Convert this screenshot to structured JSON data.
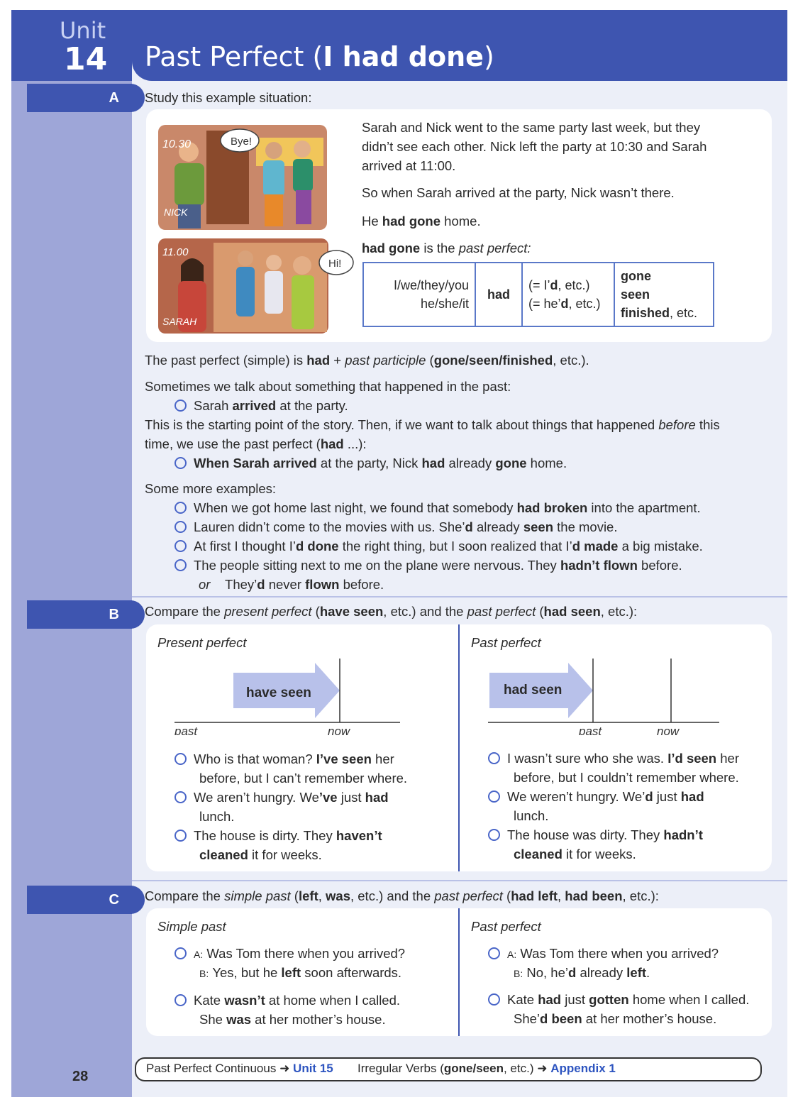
{
  "header": {
    "unit_word": "Unit",
    "unit_number": "14",
    "title_plain": "Past Perfect (",
    "title_bold": "I had done",
    "title_close": ")"
  },
  "sectionA": {
    "tab": "A",
    "intro": "Study this example situation:",
    "illustration": {
      "time1": "10.30",
      "bubble1": "Bye!",
      "name1": "NICK",
      "time2": "11.00",
      "bubble2": "Hi!",
      "name2": "SARAH"
    },
    "para1_line1": "Sarah and Nick went to the same party last week, but they",
    "para1_line2": "didn’t see each other.  Nick left the party at 10:30 and Sarah",
    "para1_line3": "arrived at 11:00.",
    "para2": "So when Sarah arrived at the party, Nick wasn’t there.",
    "para3_pre": "He ",
    "para3_bold": "had gone",
    "para3_post": " home.",
    "para4_bold": "had gone",
    "para4_mid": " is the ",
    "para4_ital": "past perfect:",
    "table": {
      "subj1": "I/we/they/you",
      "subj2": "he/she/it",
      "aux": "had",
      "c1a": "(= I’",
      "c1b": "d",
      "c1c": ", etc.)",
      "c2a": "(= he’",
      "c2b": "d",
      "c2c": ", etc.)",
      "p1": "gone",
      "p2": "seen",
      "p3": "finished",
      "p3_post": ", etc."
    },
    "def_pre": "The past perfect (simple) is ",
    "def_had": "had",
    "def_plus": " + ",
    "def_ital": "past participle",
    "def_open": " (",
    "def_bold": "gone/seen/finished",
    "def_post": ", etc.).",
    "some_past": "Sometimes we talk about something that happened in the past:",
    "ex1_pre": "Sarah ",
    "ex1_bold": "arrived",
    "ex1_post": " at the party.",
    "start_line1_pre": "This is the starting point of the story.  Then, if we want to talk about things that happened ",
    "start_line1_ital": "before",
    "start_line1_post": " this",
    "start_line2_pre": "time, we use the past perfect (",
    "start_line2_bold": "had",
    "start_line2_post": " ...):",
    "ex2_b1": "When Sarah arrived",
    "ex2_m1": " at the party, Nick ",
    "ex2_b2": "had",
    "ex2_m2": " already ",
    "ex2_b3": "gone",
    "ex2_m3": " home.",
    "more": "Some more examples:",
    "m1_pre": "When we got home last night, we found that somebody ",
    "m1_bold": "had broken",
    "m1_post": " into the apartment.",
    "m2_pre": "Lauren didn’t come to the movies with us.  She’",
    "m2_b1": "d",
    "m2_mid": " already ",
    "m2_b2": "seen",
    "m2_post": " the movie.",
    "m3_pre": "At first I thought I’",
    "m3_b1": "d done",
    "m3_mid": " the right thing, but I soon realized that I’",
    "m3_b2": "d made",
    "m3_post": " a big mistake.",
    "m4_pre": "The people sitting next to me on the plane were nervous.  They ",
    "m4_bold": "hadn’t flown",
    "m4_post": " before.",
    "m5_or": "or",
    "m5_pre": "They’",
    "m5_b1": "d",
    "m5_mid": " never ",
    "m5_b2": "flown",
    "m5_post": " before."
  },
  "sectionB": {
    "tab": "B",
    "intro_pre": "Compare the ",
    "intro_i1": "present perfect",
    "intro_m1": " (",
    "intro_b1": "have seen",
    "intro_m2": ", etc.) and the ",
    "intro_i2": "past perfect",
    "intro_m3": " (",
    "intro_b2": "had seen",
    "intro_post": ", etc.):",
    "left_heading": "Present perfect",
    "left_arrow": "have seen",
    "left_past": "past",
    "left_now": "now",
    "right_heading": "Past perfect",
    "right_arrow": "had seen",
    "right_past": "past",
    "right_now": "now",
    "l1a_pre": "Who is that woman?  ",
    "l1a_bold": "I’ve seen",
    "l1a_post": " her",
    "l1b": "before, but I can’t remember where.",
    "l2a_pre": "We aren’t hungry.  We",
    "l2a_b1": "’ve",
    "l2a_mid": " just ",
    "l2a_b2": "had",
    "l2b": "lunch.",
    "l3a_pre": "The house is dirty.  They ",
    "l3a_bold": "haven’t",
    "l3b_bold": "cleaned",
    "l3b_post": " it for weeks.",
    "r1a_pre": "I wasn’t sure who she was.  ",
    "r1a_bold": "I’d seen",
    "r1a_post": " her",
    "r1b": "before, but I couldn’t remember where.",
    "r2a_pre": "We weren’t hungry.  We’",
    "r2a_b1": "d",
    "r2a_mid": " just ",
    "r2a_b2": "had",
    "r2b": "lunch.",
    "r3a_pre": "The house was dirty.  They ",
    "r3a_bold": "hadn’t",
    "r3b_bold": "cleaned",
    "r3b_post": " it for weeks."
  },
  "sectionC": {
    "tab": "C",
    "intro_pre": "Compare the ",
    "intro_i1": "simple past",
    "intro_m1": " (",
    "intro_b1": "left",
    "intro_c1": ", ",
    "intro_b2": "was",
    "intro_m2": ", etc.) and the ",
    "intro_i2": "past perfect",
    "intro_m3": " (",
    "intro_b3": "had left",
    "intro_c2": ", ",
    "intro_b4": "had been",
    "intro_post": ", etc.):",
    "left_heading": "Simple past",
    "right_heading": "Past perfect",
    "A": "A:",
    "B": "B:",
    "l1a": "Was Tom there when you arrived?",
    "l1b_pre": "Yes, but he ",
    "l1b_bold": "left",
    "l1b_post": " soon afterwards.",
    "l2a_pre": "Kate ",
    "l2a_bold": "wasn’t",
    "l2a_post": " at home when I called.",
    "l2b_pre": "She ",
    "l2b_bold": "was",
    "l2b_post": " at her mother’s house.",
    "r1a": "Was Tom there when you arrived?",
    "r1b_pre": "No, he’",
    "r1b_b1": "d",
    "r1b_mid": " already ",
    "r1b_b2": "left",
    "r1b_post": ".",
    "r2a_pre": "Kate ",
    "r2a_b1": "had",
    "r2a_mid": " just ",
    "r2a_b2": "gotten",
    "r2a_post": " home when I called.",
    "r2b_pre": "She’",
    "r2b_bold": "d been",
    "r2b_post": " at her mother’s house."
  },
  "footer": {
    "page_number": "28",
    "ref1_text": "Past Perfect Continuous",
    "arrow": "➜",
    "ref1_link": "Unit 15",
    "ref2_pre": "Irregular Verbs (",
    "ref2_bold": "gone/seen",
    "ref2_post": ", etc.)",
    "ref2_link": "Appendix 1"
  },
  "colors": {
    "brand_blue": "#3e55b0",
    "sidebar_lavender": "#9ea6d8",
    "arrow_fill": "#b8c1ea",
    "link_blue": "#2e55c0"
  }
}
